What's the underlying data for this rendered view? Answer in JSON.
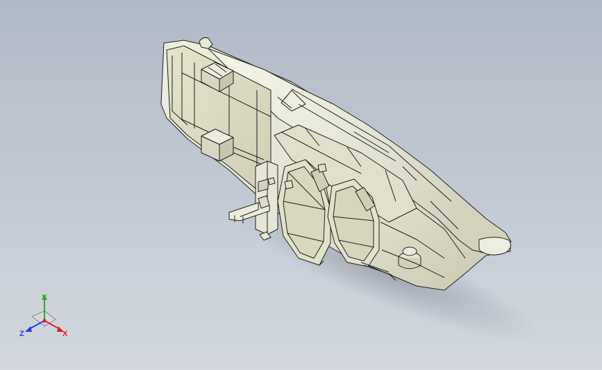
{
  "colors": {
    "background_top": "#b3bcc8",
    "background_bottom": "#ced4dc",
    "part_face": "#e6e6d8",
    "part_face_dark": "#c9c9b2",
    "part_edge": "#1f1f1f",
    "axis_x": "#e02020",
    "axis_y": "#22b022",
    "axis_z": "#2040e0"
  },
  "triad": {
    "x_label": "X",
    "y_label": "Y",
    "z_label": "Z"
  }
}
